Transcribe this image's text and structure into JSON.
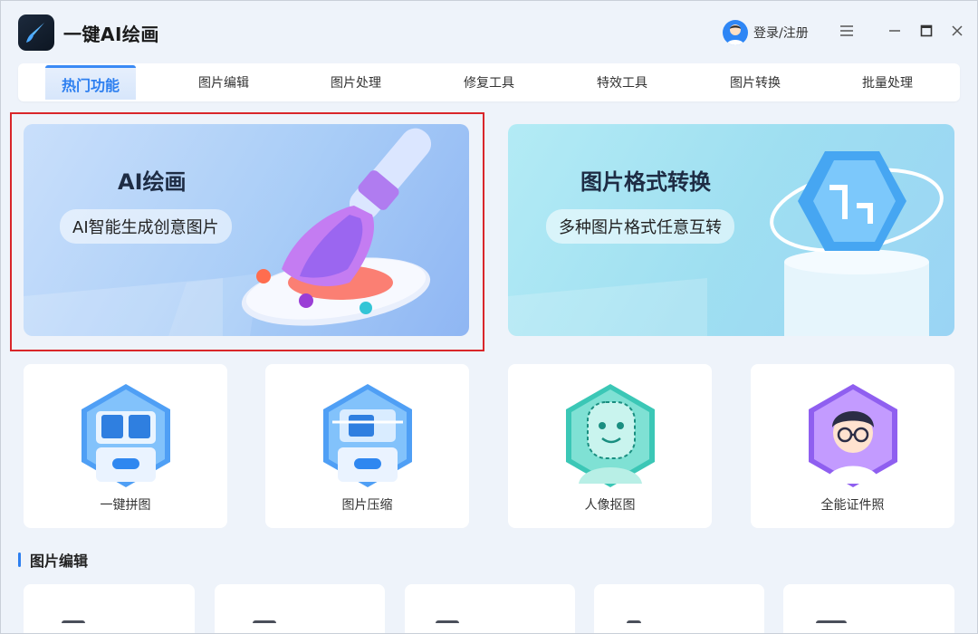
{
  "app": {
    "title": "一键AI绘画"
  },
  "header": {
    "login_label": "登录/注册"
  },
  "tabs": [
    {
      "label": "热门功能",
      "active": true
    },
    {
      "label": "图片编辑"
    },
    {
      "label": "图片处理"
    },
    {
      "label": "修复工具"
    },
    {
      "label": "特效工具"
    },
    {
      "label": "图片转换"
    },
    {
      "label": "批量处理"
    }
  ],
  "banners": [
    {
      "title": "AI绘画",
      "subtitle": "AI智能生成创意图片"
    },
    {
      "title": "图片格式转换",
      "subtitle": "多种图片格式任意互转"
    }
  ],
  "cards": [
    {
      "label": "一键拼图",
      "icon": "collage-icon"
    },
    {
      "label": "图片压缩",
      "icon": "compress-icon"
    },
    {
      "label": "人像抠图",
      "icon": "portrait-cutout-icon"
    },
    {
      "label": "全能证件照",
      "icon": "id-photo-icon"
    }
  ],
  "section": {
    "title": "图片编辑"
  },
  "colors": {
    "accent": "#2d7ff0",
    "highlight_frame": "#d9262a",
    "background": "#eef3fa"
  }
}
